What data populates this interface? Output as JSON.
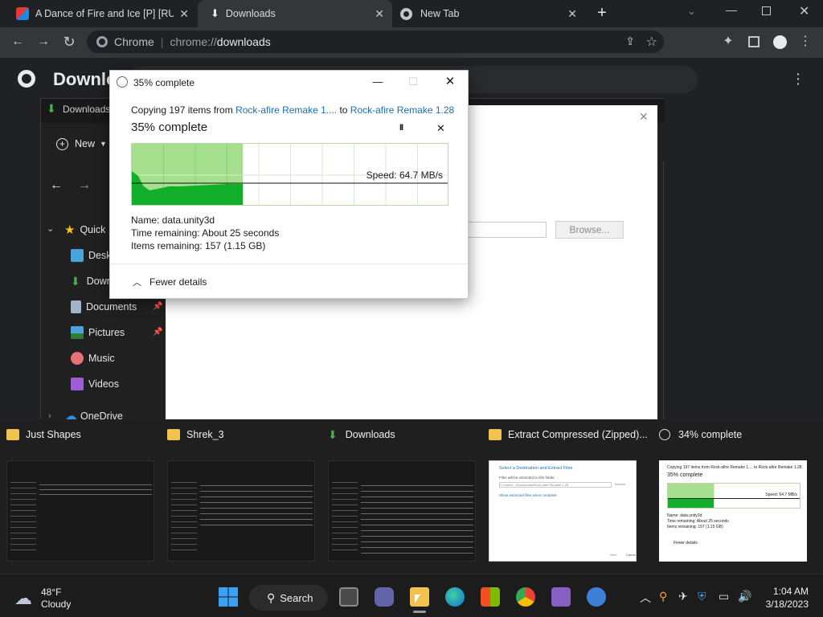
{
  "browser": {
    "tabs": [
      {
        "title": "A Dance of Fire and Ice [P] [RUS"
      },
      {
        "title": "Downloads"
      },
      {
        "title": "New Tab"
      }
    ],
    "new_tab_label": "+",
    "tab_close_label": "✕",
    "omnibox": {
      "prefix": "Chrome",
      "url_scheme": "chrome://",
      "url_path": "downloads"
    },
    "page_title": "Downlo"
  },
  "explorer": {
    "breadcrumb": "Downloads",
    "new_label": "New",
    "nav": [
      {
        "label": "Quick"
      },
      {
        "label": "Desk"
      },
      {
        "label": "Down"
      },
      {
        "label": "Documents"
      },
      {
        "label": "Pictures"
      },
      {
        "label": "Music"
      },
      {
        "label": "Videos"
      },
      {
        "label": "OneDrive"
      }
    ]
  },
  "extract_dialog": {
    "browse_label": "Browse...",
    "close_label": "✕"
  },
  "copy_dialog": {
    "window_title": "35% complete",
    "line_prefix": "Copying 197 items from ",
    "source": "Rock-afire Remake 1....",
    "line_mid": " to ",
    "dest": "Rock-afire Remake 1.28",
    "heading": "35% complete",
    "pause_label": "II",
    "close_label": "✕",
    "progress_fraction": 0.35,
    "speed_text": "Speed: 64.7 MB/s",
    "name_line": "Name:  data.unity3d",
    "time_line": "Time remaining:  About 25 seconds",
    "items_line": "Items remaining:  157 (1.15 GB)",
    "fewer_details": "Fewer details"
  },
  "previews": [
    {
      "label": "Just Shapes"
    },
    {
      "label": "Shrek_3"
    },
    {
      "label": "Downloads"
    },
    {
      "label": "Extract Compressed (Zipped)..."
    },
    {
      "label": "34% complete"
    }
  ],
  "preview_copy": {
    "line": "Copying 197 items from Rock-afire Remake 1.... to Rock-afire Remake 1.28",
    "heading": "35% complete",
    "speed": "Speed: 64.7 MB/s",
    "name": "Name: data.unity3d",
    "time": "Time remaining: About 25 seconds",
    "items": "Items remaining: 157 (1.15 GB)",
    "fewer": "Fewer details"
  },
  "preview_extract": {
    "title": "Select a Destination and Extract Files",
    "subtitle": "Files will be extracted to this folder:",
    "path": "C:\\Users\\...\\Downloads\\Rock-afire Remake 1.28",
    "browse": "Browse...",
    "checkbox": "Show extracted files when complete",
    "extract": "Next",
    "cancel": "Cancel"
  },
  "taskbar": {
    "weather_temp": "48°F",
    "weather_desc": "Cloudy",
    "search_label": "Search",
    "time": "1:04 AM",
    "date": "3/18/2023"
  },
  "colors": {
    "graph_fill": "#12b02a",
    "graph_light": "#a6e08e",
    "link_blue": "#1a6fb4",
    "folder_yellow": "#f2c14e"
  }
}
